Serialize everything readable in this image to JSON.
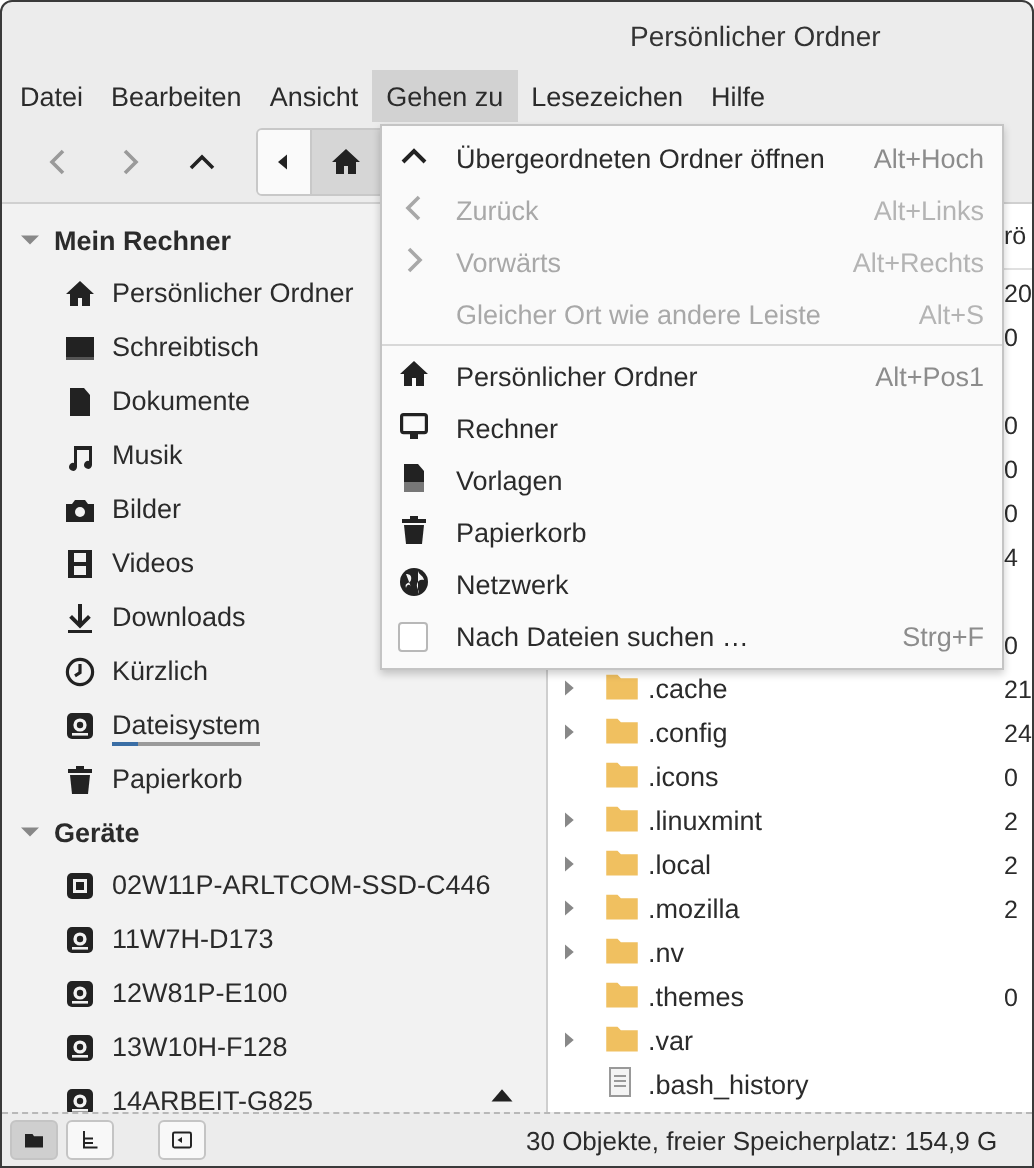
{
  "window": {
    "title": "Persönlicher Ordner"
  },
  "menubar": [
    {
      "label": "Datei",
      "selected": false
    },
    {
      "label": "Bearbeiten",
      "selected": false
    },
    {
      "label": "Ansicht",
      "selected": false
    },
    {
      "label": "Gehen zu",
      "selected": true
    },
    {
      "label": "Lesezeichen",
      "selected": false
    },
    {
      "label": "Hilfe",
      "selected": false
    }
  ],
  "toolbar": {
    "buttons": [
      {
        "disabled": true
      },
      {
        "disabled": true
      },
      {
        "disabled": false
      }
    ]
  },
  "sidebar": {
    "sections": [
      {
        "title": "Mein Rechner",
        "expanded": true,
        "items": [
          {
            "label": "Persönlicher Ordner"
          },
          {
            "label": "Schreibtisch"
          },
          {
            "label": "Dokumente"
          },
          {
            "label": "Musik"
          },
          {
            "label": "Bilder"
          },
          {
            "label": "Videos"
          },
          {
            "label": "Downloads"
          },
          {
            "label": "Kürzlich"
          },
          {
            "label": "Dateisystem",
            "level": 0.17
          },
          {
            "label": "Papierkorb"
          }
        ]
      },
      {
        "title": "Geräte",
        "expanded": true,
        "items": [
          {
            "label": "02W11P-ARLTCOM-SSD-C446",
            "ejectable": false
          },
          {
            "label": "11W7H-D173",
            "ejectable": false
          },
          {
            "label": "12W81P-E100",
            "ejectable": false
          },
          {
            "label": "13W10H-F128",
            "ejectable": false
          },
          {
            "label": "14ARBEIT-G825",
            "ejectable": true
          }
        ]
      }
    ]
  },
  "file_list": {
    "size_header": "rö",
    "rows": [
      {
        "kind": "hidden",
        "size": "20"
      },
      {
        "kind": "hidden",
        "size": "0"
      },
      {
        "kind": "hidden"
      },
      {
        "kind": "hidden",
        "size": "0"
      },
      {
        "kind": "hidden",
        "size": "0"
      },
      {
        "kind": "hidden",
        "size": "0"
      },
      {
        "kind": "hidden",
        "size": "4"
      },
      {
        "kind": "hidden"
      },
      {
        "kind": "hidden",
        "size": "0"
      },
      {
        "kind": "folder",
        "name": ".cache",
        "expandable": true,
        "size": "21"
      },
      {
        "kind": "folder",
        "name": ".config",
        "expandable": true,
        "size": "24"
      },
      {
        "kind": "folder",
        "name": ".icons",
        "expandable": false,
        "size": "0"
      },
      {
        "kind": "folder",
        "name": ".linuxmint",
        "expandable": true,
        "size": "2"
      },
      {
        "kind": "folder",
        "name": ".local",
        "expandable": true,
        "size": "2"
      },
      {
        "kind": "folder",
        "name": ".mozilla",
        "expandable": true,
        "size": "2"
      },
      {
        "kind": "folder",
        "name": ".nv",
        "expandable": true
      },
      {
        "kind": "folder",
        "name": ".themes",
        "expandable": false,
        "size": "0"
      },
      {
        "kind": "folder",
        "name": ".var",
        "expandable": true
      },
      {
        "kind": "file",
        "name": ".bash_history",
        "expandable": false
      }
    ]
  },
  "menu": {
    "items": [
      {
        "kind": "command",
        "label": "Übergeordneten Ordner öffnen",
        "shortcut": "Alt+Hoch",
        "disabled": false
      },
      {
        "kind": "command",
        "label": "Zurück",
        "shortcut": "Alt+Links",
        "disabled": true
      },
      {
        "kind": "command",
        "label": "Vorwärts",
        "shortcut": "Alt+Rechts",
        "disabled": true
      },
      {
        "kind": "command",
        "label": "Gleicher Ort wie andere Leiste",
        "shortcut": "Alt+S",
        "disabled": true
      },
      {
        "kind": "separator"
      },
      {
        "kind": "command",
        "label": "Persönlicher Ordner",
        "shortcut": "Alt+Pos1",
        "disabled": false
      },
      {
        "kind": "command",
        "label": "Rechner",
        "disabled": false
      },
      {
        "kind": "command",
        "label": "Vorlagen",
        "disabled": false
      },
      {
        "kind": "command",
        "label": "Papierkorb",
        "disabled": false
      },
      {
        "kind": "command",
        "label": "Netzwerk",
        "disabled": false
      },
      {
        "kind": "check",
        "label": "Nach Dateien suchen …",
        "shortcut": "Strg+F",
        "checked": false,
        "disabled": false
      }
    ]
  },
  "status_bar": {
    "view_buttons": [
      {
        "selected": true
      },
      {
        "selected": false
      }
    ],
    "text": "30 Objekte, freier Speicherplatz: 154,9 G"
  }
}
